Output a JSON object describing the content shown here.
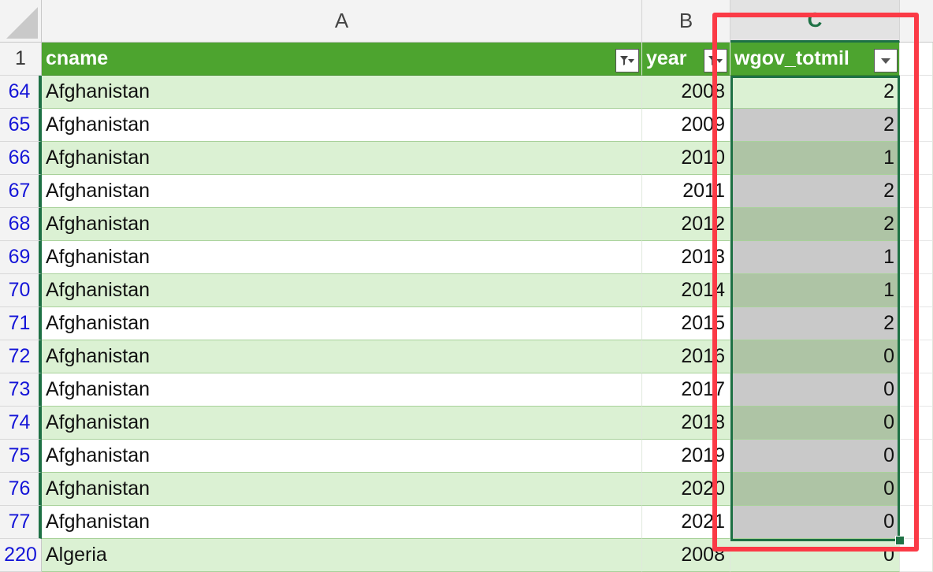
{
  "columns": [
    "A",
    "B",
    "C"
  ],
  "header_row": {
    "row_number": "1",
    "cname": "cname",
    "year": "year",
    "wgov_totmil": "wgov_totmil"
  },
  "rows": [
    {
      "row": "64",
      "cname": "Afghanistan",
      "year": "2008",
      "wgov_totmil": "2"
    },
    {
      "row": "65",
      "cname": "Afghanistan",
      "year": "2009",
      "wgov_totmil": "2"
    },
    {
      "row": "66",
      "cname": "Afghanistan",
      "year": "2010",
      "wgov_totmil": "1"
    },
    {
      "row": "67",
      "cname": "Afghanistan",
      "year": "2011",
      "wgov_totmil": "2"
    },
    {
      "row": "68",
      "cname": "Afghanistan",
      "year": "2012",
      "wgov_totmil": "2"
    },
    {
      "row": "69",
      "cname": "Afghanistan",
      "year": "2013",
      "wgov_totmil": "1"
    },
    {
      "row": "70",
      "cname": "Afghanistan",
      "year": "2014",
      "wgov_totmil": "1"
    },
    {
      "row": "71",
      "cname": "Afghanistan",
      "year": "2015",
      "wgov_totmil": "2"
    },
    {
      "row": "72",
      "cname": "Afghanistan",
      "year": "2016",
      "wgov_totmil": "0"
    },
    {
      "row": "73",
      "cname": "Afghanistan",
      "year": "2017",
      "wgov_totmil": "0"
    },
    {
      "row": "74",
      "cname": "Afghanistan",
      "year": "2018",
      "wgov_totmil": "0"
    },
    {
      "row": "75",
      "cname": "Afghanistan",
      "year": "2019",
      "wgov_totmil": "0"
    },
    {
      "row": "76",
      "cname": "Afghanistan",
      "year": "2020",
      "wgov_totmil": "0"
    },
    {
      "row": "77",
      "cname": "Afghanistan",
      "year": "2021",
      "wgov_totmil": "0"
    },
    {
      "row": "220",
      "cname": "Algeria",
      "year": "2008",
      "wgov_totmil": "0"
    }
  ],
  "icons": {
    "filter_cname": "filter-active-icon",
    "filter_year": "filter-active-icon",
    "dropdown_wgov": "dropdown-arrow-icon"
  },
  "colors": {
    "header_green": "#4da42f",
    "band_green": "#dbf1d3",
    "selection_green": "#1e7145",
    "highlight_red": "#fb3a46",
    "row_number_blue": "#1515d8"
  }
}
